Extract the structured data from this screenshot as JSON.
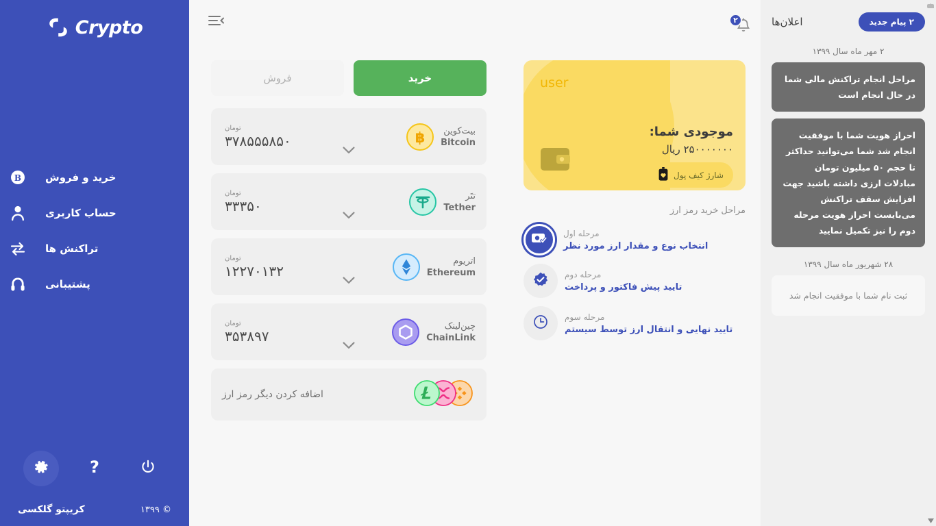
{
  "brand": {
    "name": "Crypto",
    "logo_icon": "crypto-logo-icon"
  },
  "sidebar": {
    "items": [
      {
        "label": "خرید و فروش",
        "icon": "bitcoin-circle-icon"
      },
      {
        "label": "حساب کاربری",
        "icon": "user-icon"
      },
      {
        "label": "تراکنش ها",
        "icon": "transfer-arrows-icon"
      },
      {
        "label": "پشتیبانی",
        "icon": "headset-icon"
      }
    ],
    "actions": [
      {
        "name": "settings-button",
        "icon": "gear-icon",
        "active": true
      },
      {
        "name": "help-button",
        "icon": "question-mark-icon",
        "active": false
      },
      {
        "name": "power-button",
        "icon": "power-icon",
        "active": false
      }
    ],
    "footer": {
      "company": "کریپتو گلکسی",
      "copyright": "© ۱۳۹۹"
    },
    "bg_color": "#3d50b8"
  },
  "topbar": {
    "menu_icon": "hamburger-collapse-icon",
    "bell_icon": "bell-icon",
    "bell_badge": "۲"
  },
  "wallet": {
    "user_label": "user",
    "balance_title": "موجودی شما:",
    "balance_amount": "۲۵۰۰۰۰۰۰۰ ریال",
    "charge_label": "شارژ کیف پول",
    "charge_icon": "battery-heart-icon",
    "wallet_icon": "wallet-icon",
    "card_color": "#fbe38b",
    "accent_color": "#fada62"
  },
  "steps": {
    "title": "مراحل خرید رمز ارز",
    "items": [
      {
        "label": "مرحله اول",
        "desc": "انتخاب نوع و مقدار ارز مورد نظر",
        "icon": "card-check-icon",
        "active": true
      },
      {
        "label": "مرحله دوم",
        "desc": "تایید پیش فاکتور و پرداخت",
        "icon": "badge-check-icon",
        "active": false
      },
      {
        "label": "مرحله سوم",
        "desc": "تایید نهایی و انتقال ارز توسط سیستم",
        "icon": "clock-icon",
        "active": false
      }
    ]
  },
  "trade": {
    "tabs": [
      {
        "label": "خرید",
        "state": "active",
        "color": "#56b25b"
      },
      {
        "label": "فروش",
        "state": "inactive"
      }
    ],
    "unit_label": "تومان",
    "coins": [
      {
        "fa": "بیت‌کوین",
        "en": "Bitcoin",
        "price": "۳۷۸۵۵۵۸۵۰",
        "icon": "bitcoin-icon",
        "color": "#f5c518",
        "bg": "#fde9a0"
      },
      {
        "fa": "تتَر",
        "en": "Tether",
        "price": "۳۳۳۵۰",
        "icon": "tether-icon",
        "color": "#26c6a5",
        "bg": "#c7f3e6"
      },
      {
        "fa": "اتریوم",
        "en": "Ethereum",
        "price": "۱۲۲۷۰۱۳۲",
        "icon": "ethereum-icon",
        "color": "#57b6f5",
        "bg": "#d5ecfd"
      },
      {
        "fa": "چین‌لینک",
        "en": "ChainLink",
        "price": "۳۵۳۸۹۷",
        "icon": "chainlink-icon",
        "color": "#6c5ce7",
        "bg": "#a99cf0"
      }
    ],
    "add_row": {
      "label": "اضافه کردن دیگر رمز ارز",
      "icons": [
        {
          "name": "litecoin-icon",
          "color": "#3ddc6f",
          "bg": "#bcf7cd"
        },
        {
          "name": "ripple-icon",
          "color": "#ef2d84",
          "bg": "#fbb3d3"
        },
        {
          "name": "binance-icon",
          "color": "#f7931a",
          "bg": "#fcd7ab"
        }
      ]
    },
    "chevron_icon": "chevron-down-icon"
  },
  "announcements": {
    "title": "اعلان‌ها",
    "new_badge": "۲ پیام جدید",
    "groups": [
      {
        "date": "۲ مهر ماه سال ۱۳۹۹",
        "messages": [
          {
            "text": "مراحل انجام تراکنش مالی شما در حال انجام است",
            "style": "dark"
          },
          {
            "text": "احراز هویت شما با موفقیت انجام شد شما می‌توانید حداکثر تا حجم ۵۰ میلیون تومان مبادلات ارزی داشته باشید جهت افزایش سقف تراکنش می‌بایست احراز هویت مرحله دوم را نیز تکمیل نمایید",
            "style": "dark"
          }
        ]
      },
      {
        "date": "۲۸ شهریور ماه سال ۱۳۹۹",
        "messages": [
          {
            "text": "ثبت نام شما با موفقیت انجام شد",
            "style": "light"
          }
        ]
      }
    ]
  },
  "scrollbar": {
    "up_icon": "scroll-up-arrow-icon",
    "down_icon": "scroll-down-arrow-icon"
  }
}
